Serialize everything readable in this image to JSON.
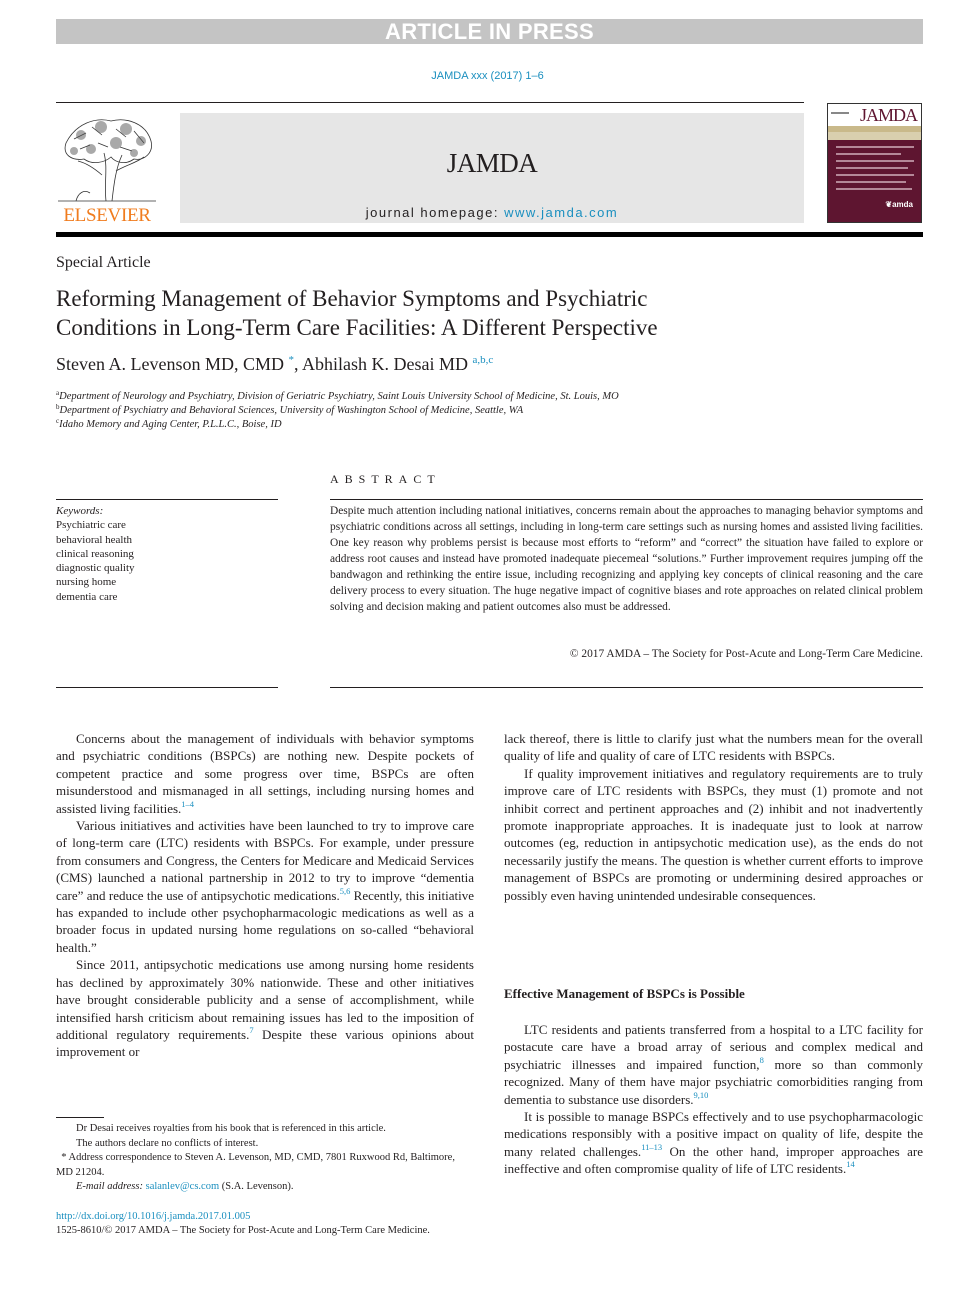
{
  "banner": {
    "label": "ARTICLE IN PRESS"
  },
  "citation": "JAMDA xxx (2017) 1–6",
  "header": {
    "publisher_logo_text": "ELSEVIER",
    "journal_title": "JAMDA",
    "homepage_label": "journal homepage: ",
    "homepage_url": "www.jamda.com",
    "cover_title": "JAMDA",
    "cover_logo": "❦amda"
  },
  "article": {
    "type": "Special Article",
    "title_line1": "Reforming Management of Behavior Symptoms and Psychiatric",
    "title_line2": "Conditions in Long-Term Care Facilities: A Different Perspective",
    "authors": [
      {
        "name": "Steven A. Levenson MD, CMD",
        "marks": "*"
      },
      {
        "name": "Abhilash K. Desai MD",
        "marks": "a,b,c"
      }
    ],
    "affiliations": [
      {
        "mark": "a",
        "text": "Department of Neurology and Psychiatry, Division of Geriatric Psychiatry, Saint Louis University School of Medicine, St. Louis, MO"
      },
      {
        "mark": "b",
        "text": "Department of Psychiatry and Behavioral Sciences, University of Washington School of Medicine, Seattle, WA"
      },
      {
        "mark": "c",
        "text": "Idaho Memory and Aging Center, P.L.L.C., Boise, ID"
      }
    ]
  },
  "keywords": {
    "label": "Keywords:",
    "items": [
      "Psychiatric care",
      "behavioral health",
      "clinical reasoning",
      "diagnostic quality",
      "nursing home",
      "dementia care"
    ]
  },
  "abstract": {
    "heading": "ABSTRACT",
    "text": "Despite much attention including national initiatives, concerns remain about the approaches to managing behavior symptoms and psychiatric conditions across all settings, including in long-term care settings such as nursing homes and assisted living facilities. One key reason why problems persist is because most efforts to “reform” and “correct” the situation have failed to explore or address root causes and instead have promoted inadequate piecemeal “solutions.” Further improvement requires jumping off the bandwagon and rethinking the entire issue, including recognizing and applying key concepts of clinical reasoning and the care delivery process to every situation. The huge negative impact of cognitive biases and rote approaches on related clinical problem solving and decision making and patient outcomes also must be addressed.",
    "copyright": "© 2017 AMDA – The Society for Post-Acute and Long-Term Care Medicine."
  },
  "body": {
    "left": [
      {
        "parts": [
          "Concerns about the management of individuals with behavior symptoms and psychiatric conditions (BSPCs) are nothing new. Despite pockets of competent practice and some progress over time, BSPCs are often misunderstood and mismanaged in all settings, including nursing homes and assisted living facilities.",
          "1–4",
          ""
        ]
      },
      {
        "parts": [
          "Various initiatives and activities have been launched to try to improve care of long-term care (LTC) residents with BSPCs. For example, under pressure from consumers and Congress, the Centers for Medicare and Medicaid Services (CMS) launched a national partnership in 2012 to try to improve “dementia care” and reduce the use of antipsychotic medications.",
          "5,6",
          " Recently, this initiative has expanded to include other psychopharmacologic medications as well as a broader focus in updated nursing home regulations on so-called “behavioral health.”"
        ]
      },
      {
        "parts": [
          "Since 2011, antipsychotic medications use among nursing home residents has declined by approximately 30% nationwide. These and other initiatives have brought considerable publicity and a sense of accomplishment, while intensified harsh criticism about remaining issues has led to the imposition of additional regulatory requirements.",
          "7",
          " Despite these various opinions about improvement or"
        ]
      }
    ],
    "right": [
      {
        "text": "lack thereof, there is little to clarify just what the numbers mean for the overall quality of life and quality of care of LTC residents with BSPCs."
      },
      {
        "text": "If quality improvement initiatives and regulatory requirements are to truly improve care of LTC residents with BSPCs, they must (1) promote and not inhibit correct and pertinent approaches and (2) inhibit and not inadvertently promote inappropriate approaches. It is inadequate just to look at narrow outcomes (eg, reduction in antipsychotic medication use), as the ends do not necessarily justify the means. The question is whether current efforts to improve management of BSPCs are promoting or undermining desired approaches or possibly even having unintended undesirable consequences."
      }
    ],
    "section_heading": "Effective Management of BSPCs is Possible",
    "section_paragraphs": [
      {
        "parts": [
          "LTC residents and patients transferred from a hospital to a LTC facility for postacute care have a broad array of serious and complex medical and psychiatric illnesses and impaired function,",
          "8",
          " more so than commonly recognized. Many of them have major psychiatric comorbidities ranging from dementia to substance use disorders.",
          "9,10",
          ""
        ]
      },
      {
        "parts": [
          "It is possible to manage BSPCs effectively and to use psychopharmacologic medications responsibly with a positive impact on quality of life, despite the many related challenges.",
          "11–13",
          " On the other hand, improper approaches are ineffective and often compromise quality of life of LTC residents.",
          "14",
          ""
        ]
      }
    ]
  },
  "footnotes": {
    "disclosure1": "Dr Desai receives royalties from his book that is referenced in this article.",
    "disclosure2": "The authors declare no conflicts of interest.",
    "correspondence_mark": "*",
    "correspondence": " Address correspondence to Steven A. Levenson, MD, CMD, 7801 Ruxwood Rd, Baltimore, MD 21204.",
    "email_label": "E-mail address:",
    "email": "salanlev@cs.com",
    "email_owner": " (S.A. Levenson).",
    "doi": "http://dx.doi.org/10.1016/j.jamda.2017.01.005",
    "issn": "1525-8610/© 2017 AMDA – The Society for Post-Acute and Long-Term Care Medicine."
  },
  "colors": {
    "link": "#1a8fbf",
    "elsevier_orange": "#f07c1e",
    "cover_maroon": "#5e1530",
    "banner_gray": "#c4c4c4"
  }
}
